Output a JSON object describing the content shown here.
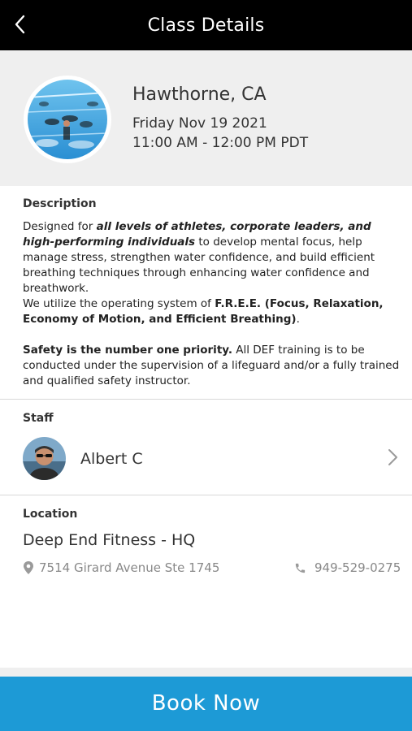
{
  "topbar": {
    "title": "Class Details",
    "back_icon": "chevron-left-icon"
  },
  "class_header": {
    "location_city": "Hawthorne, CA",
    "date": "Friday Nov 19 2021",
    "time": "11:00 AM - 12:00 PM PDT",
    "image": "pool-swimmers-photo"
  },
  "description": {
    "label": "Description",
    "p1_a": "Designed for ",
    "p1_b": "all levels of athletes, corporate leaders, and high-performing individuals",
    "p1_c": " to develop mental focus, help manage stress, strengthen water confidence, and build efficient breathing techniques through enhancing water confidence and breathwork.",
    "p2_a": "We utilize the operating system of ",
    "p2_b": "F.R.E.E. (Focus, Relaxation, Economy of Motion, and Efficient Breathing)",
    "p2_c": ".",
    "p3_a": "Safety is the number one priority.",
    "p3_b": " All DEF training is to be conducted under the supervision of a lifeguard and/or a fully trained and qualified safety instructor."
  },
  "staff": {
    "label": "Staff",
    "name": "Albert C",
    "chevron_icon": "chevron-right-icon"
  },
  "location": {
    "label": "Location",
    "name": "Deep End Fitness - HQ",
    "address": "7514 Girard Avenue Ste 1745",
    "phone": "949-529-0275",
    "pin_icon": "map-pin-icon",
    "phone_icon": "phone-icon"
  },
  "actions": {
    "book_label": "Book Now"
  },
  "colors": {
    "topbar_bg": "#000000",
    "header_bg": "#efefef",
    "book_button_bg": "#1d9ad6"
  }
}
